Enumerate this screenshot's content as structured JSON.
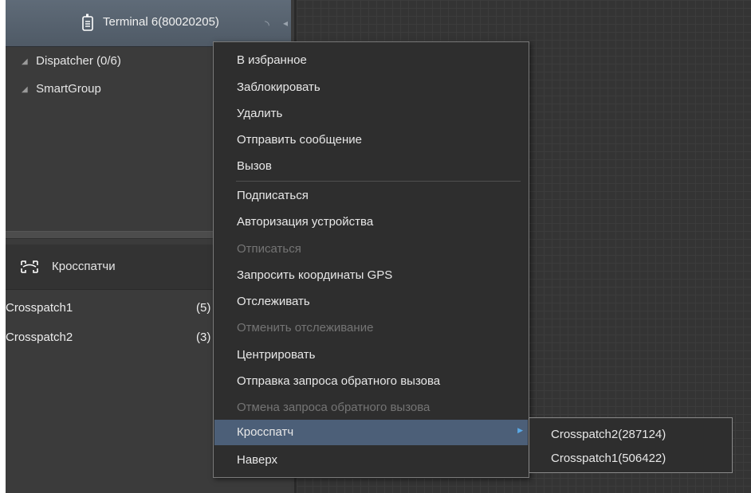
{
  "terminal": {
    "title": "Terminal 6(80020205)",
    "icon": "radio-icon",
    "signal_icon": "wifi-signal-icon"
  },
  "tree": {
    "items": [
      {
        "label": "Dispatcher (0/6)",
        "icon": "triangle-collapse-icon"
      },
      {
        "label": "SmartGroup",
        "icon": "triangle-collapse-icon"
      }
    ]
  },
  "crosspatch_panel": {
    "title": "Кросспатчи",
    "icon": "crosspatch-icon",
    "rows": [
      {
        "name": "Crosspatch1",
        "count": "(5)"
      },
      {
        "name": "Crosspatch2",
        "count": "(3)"
      }
    ]
  },
  "context_menu": {
    "items": [
      {
        "label": "В избранное",
        "enabled": true
      },
      {
        "label": "Заблокировать",
        "enabled": true
      },
      {
        "label": "Удалить",
        "enabled": true
      },
      {
        "label": "Отправить сообщение",
        "enabled": true
      },
      {
        "label": "Вызов",
        "enabled": true
      },
      {
        "label": "Подписаться",
        "enabled": true
      },
      {
        "label": "Авторизация устройства",
        "enabled": true
      },
      {
        "label": "Отписаться",
        "enabled": false
      },
      {
        "label": "Запросить координаты GPS",
        "enabled": true
      },
      {
        "label": "Отслеживать",
        "enabled": true
      },
      {
        "label": "Отменить отслеживание",
        "enabled": false
      },
      {
        "label": "Центрировать",
        "enabled": true
      },
      {
        "label": "Отправка запроса обратного вызова",
        "enabled": true
      },
      {
        "label": "Отмена запроса обратного вызова",
        "enabled": false
      },
      {
        "label": "Кросспатч",
        "enabled": true,
        "highlighted": true,
        "has_submenu": true
      },
      {
        "label": "Наверх",
        "enabled": true
      }
    ]
  },
  "submenu": {
    "items": [
      {
        "label": "Crosspatch2(287124)"
      },
      {
        "label": "Crosspatch1(506422)"
      }
    ]
  },
  "colors": {
    "highlight": "#4c5f78",
    "submenu_arrow": "#5aa9e6",
    "disabled_text": "#747474"
  }
}
